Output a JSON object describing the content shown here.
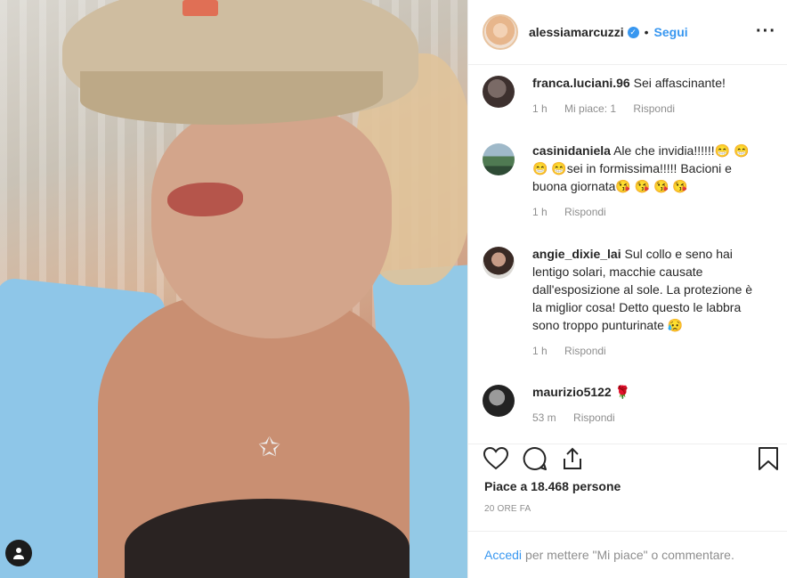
{
  "post": {
    "image_alt": "woman wearing beige cap and light blue shirt with star necklace",
    "author": "alessiamarcuzzi",
    "follow_label": "Segui",
    "separator": "•"
  },
  "comments": [
    {
      "user": "franca.luciani.96",
      "text": "Sei affascinante!",
      "time": "1 h",
      "likes": "Mi piace: 1",
      "reply": "Rispondi"
    },
    {
      "user": "casinidaniela",
      "text": "Ale che invidia!!!!!!😁 😁 😁 😁sei in formissima!!!!! Bacioni e buona giornata😘 😘 😘 😘",
      "time": "1 h",
      "reply": "Rispondi"
    },
    {
      "user": "angie_dixie_lai",
      "text": "Sul collo e seno hai lentigo solari, macchie causate dall'esposizione al sole. La protezione è la miglior cosa! Detto questo le labbra sono troppo punturinate 😥",
      "time": "1 h",
      "reply": "Rispondi"
    },
    {
      "user": "maurizio5122",
      "text": "🌹",
      "time": "53 m",
      "reply": "Rispondi"
    }
  ],
  "actions": {
    "icons": [
      "heart-icon",
      "comment-icon",
      "share-icon",
      "bookmark-icon"
    ]
  },
  "likes_text": "Piace a 18.468 persone",
  "timestamp": "20 ORE FA",
  "footer": {
    "login_label": "Accedi",
    "rest": "per mettere \"Mi piace\" o commentare."
  },
  "colors": {
    "accent": "#3897f0",
    "muted": "#8e8e8e",
    "text": "#262626"
  }
}
